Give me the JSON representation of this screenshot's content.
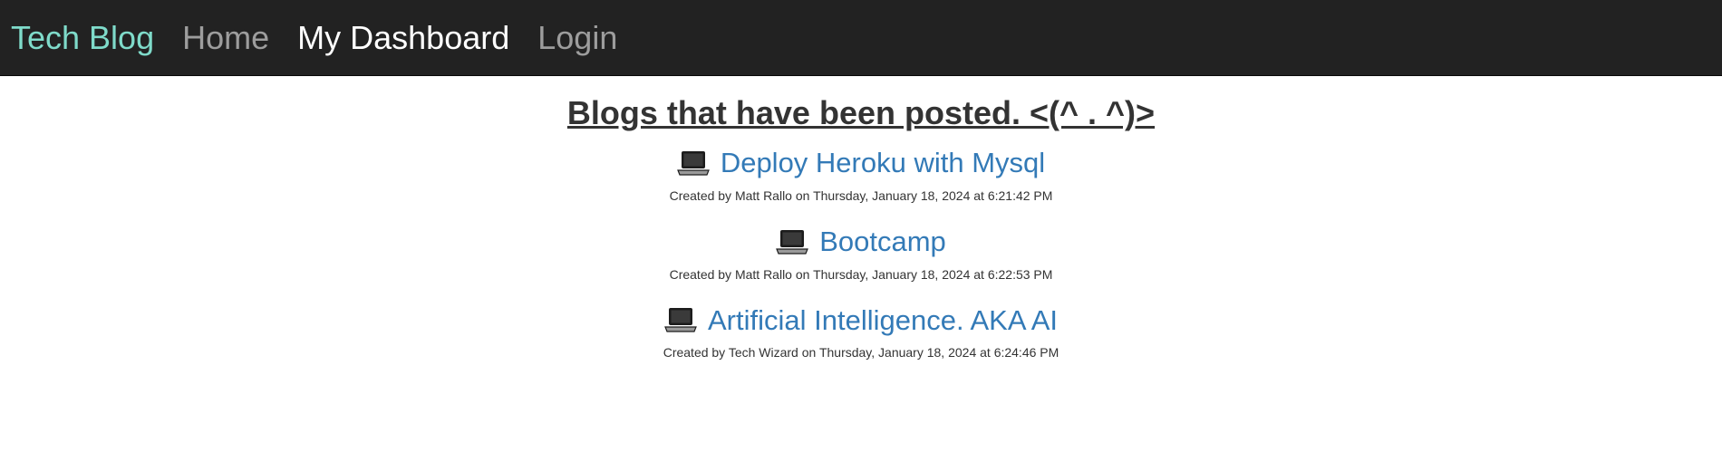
{
  "nav": {
    "brand": "Tech Blog",
    "items": [
      "Home",
      "My Dashboard",
      "Login"
    ],
    "active": "My Dashboard"
  },
  "main": {
    "title": "Blogs that have been posted. <(^ . ^)>",
    "posts": [
      {
        "title": "Deploy Heroku with Mysql",
        "meta": "Created by Matt Rallo on Thursday, January 18, 2024 at 6:21:42 PM",
        "icon": "laptop-icon"
      },
      {
        "title": "Bootcamp",
        "meta": "Created by Matt Rallo on Thursday, January 18, 2024 at 6:22:53 PM",
        "icon": "laptop-icon"
      },
      {
        "title": "Artificial Intelligence. AKA AI",
        "meta": "Created by Tech Wizard on Thursday, January 18, 2024 at 6:24:46 PM",
        "icon": "laptop-icon"
      }
    ]
  },
  "colors": {
    "navbar_bg": "#222222",
    "brand": "#7fdbca",
    "link": "#337ab7",
    "text": "#333333",
    "nav_inactive": "#9d9d9d"
  }
}
